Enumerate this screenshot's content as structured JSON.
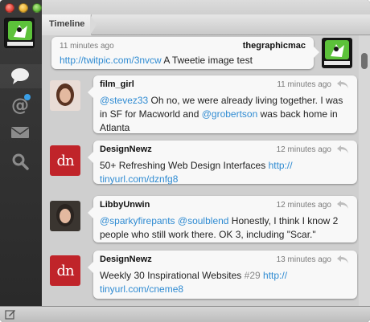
{
  "window": {
    "title": "Timeline"
  },
  "sidebar": {
    "account": {
      "name": "the Graphic Mac"
    },
    "items": [
      {
        "id": "timeline",
        "icon": "speech-bubble-icon",
        "selected": true
      },
      {
        "id": "mentions",
        "icon": "at-sign-icon",
        "badge_color": "#3aa0e8"
      },
      {
        "id": "messages",
        "icon": "envelope-icon"
      },
      {
        "id": "search",
        "icon": "magnifier-icon"
      }
    ]
  },
  "header": {
    "breadcrumb": "Timeline"
  },
  "own_tweet": {
    "time": "11 minutes ago",
    "user": "thegraphicmac",
    "link": "http://twitpic.com/3nvcw",
    "text": " A Tweetie image test"
  },
  "tweets": [
    {
      "user": "film_girl",
      "time": "11 minutes ago",
      "parts": [
        {
          "t": "@stevez33",
          "link": true
        },
        {
          "t": " Oh no, we were already living together. I was in SF for Macworld and "
        },
        {
          "t": "@grobertson",
          "link": true
        },
        {
          "t": " was back home in Atlanta"
        }
      ]
    },
    {
      "user": "DesignNewz",
      "time": "12 minutes ago",
      "avatar_text": "dn",
      "parts": [
        {
          "t": "50+ Refreshing Web Design Interfaces "
        },
        {
          "t": "http://\ntinyurl.com/dznfg8",
          "link": true
        }
      ]
    },
    {
      "user": "LibbyUnwin",
      "time": "12 minutes ago",
      "parts": [
        {
          "t": "@sparkyfirepants",
          "link": true
        },
        {
          "t": " "
        },
        {
          "t": "@soulblend",
          "link": true
        },
        {
          "t": " Honestly, I think I know 2 people who still work there. OK 3, including \"Scar.\""
        }
      ]
    },
    {
      "user": "DesignNewz",
      "time": "13 minutes ago",
      "avatar_text": "dn",
      "parts": [
        {
          "t": "Weekly 30 Inspirational Websites "
        },
        {
          "t": "#29",
          "hash": true
        },
        {
          "t": " "
        },
        {
          "t": "http://\ntinyurl.com/cneme8",
          "link": true
        }
      ]
    }
  ],
  "colors": {
    "link": "#2f8bd2",
    "dn_red": "#c0242a"
  }
}
